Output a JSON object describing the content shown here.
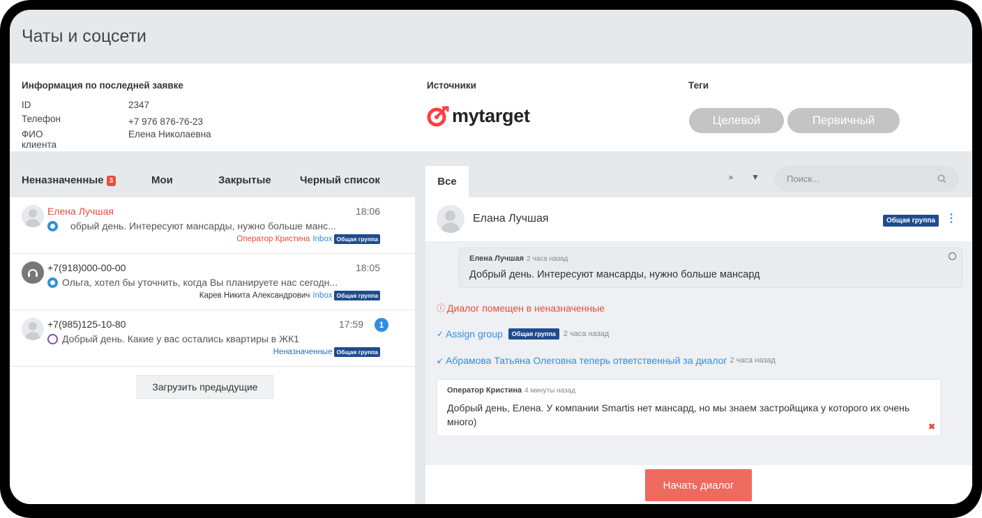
{
  "header": {
    "title": "Чаты и соцсети"
  },
  "info": {
    "title": "Информация по последней заявке",
    "rows": [
      {
        "key": "ID",
        "value": "2347"
      },
      {
        "key": "Телефон",
        "value": "+7 976 876-76-23"
      },
      {
        "key": "ФИО клиента",
        "value": "Елена Николаевна"
      }
    ]
  },
  "sources": {
    "title": "Источники",
    "logo_text": "mytarget",
    "logo_color": "#ff3f3f"
  },
  "tags": {
    "title": "Теги",
    "items": [
      "Целевой",
      "Первичный"
    ]
  },
  "left_tabs": {
    "unassigned": "Неназначенные",
    "unassigned_count": "3",
    "mine": "Мои",
    "closed": "Закрытые",
    "blacklist": "Черный список"
  },
  "conversations": [
    {
      "name": "Елена Лучшая",
      "time": "18:06",
      "channel": "telegram-icon",
      "preview": "обрый день. Интересуют мансарды, нужно больше манс...",
      "operator": "Оператор Кристина",
      "inbox": "Inbox",
      "group": "Общая группа"
    },
    {
      "name": "+7(918)000-00-00",
      "time": "18:05",
      "channel": "telegram-icon",
      "preview": "Ольга, хотел бы уточнить, когда Вы планируете нас сегодн...",
      "operator": "Карев Никита Александрович",
      "inbox": "Inbox",
      "group": "Общая группа"
    },
    {
      "name": "+7(985)125-10-80",
      "time": "17:59",
      "unread": "1",
      "channel": "viber-icon",
      "preview": "Добрый день. Какие у вас остались квартиры в ЖК1",
      "status": "Неназначенные",
      "group": "Общая группа"
    }
  ],
  "load_more": "Загрузить предыдущие",
  "right": {
    "tab_all": "Все",
    "search_placeholder": "Поиск...",
    "chat_title": "Елана Лучшая",
    "chat_group": "Общая группа",
    "incoming": {
      "author": "Елена Лучшая",
      "ago": "2 часа назад",
      "text": "Добрый день. Интересуют мансарды, нужно больше мансард"
    },
    "event_unassigned": "Диалог помещен в неназначенные",
    "event_assign": {
      "label": "Assign group",
      "group": "Общая группа",
      "ago": "2 часа назад"
    },
    "event_responsible": {
      "text": "Абрамова Татьяна Олеговна теперь ответственный за диалог",
      "ago": "2 часа назад"
    },
    "outgoing": {
      "author": "Оператор Кристина",
      "ago": "4 минуты назад",
      "text": "Добрый день, Елена. У компании Smartis нет мансард, но мы знаем застройщика у которого их очень много)"
    },
    "start_button": "Начать диалог"
  },
  "colors": {
    "accent_red": "#e84c3d",
    "accent_blue": "#2f8fde",
    "chip": "#1f4b8f",
    "start_button": "#ee6a5f"
  }
}
